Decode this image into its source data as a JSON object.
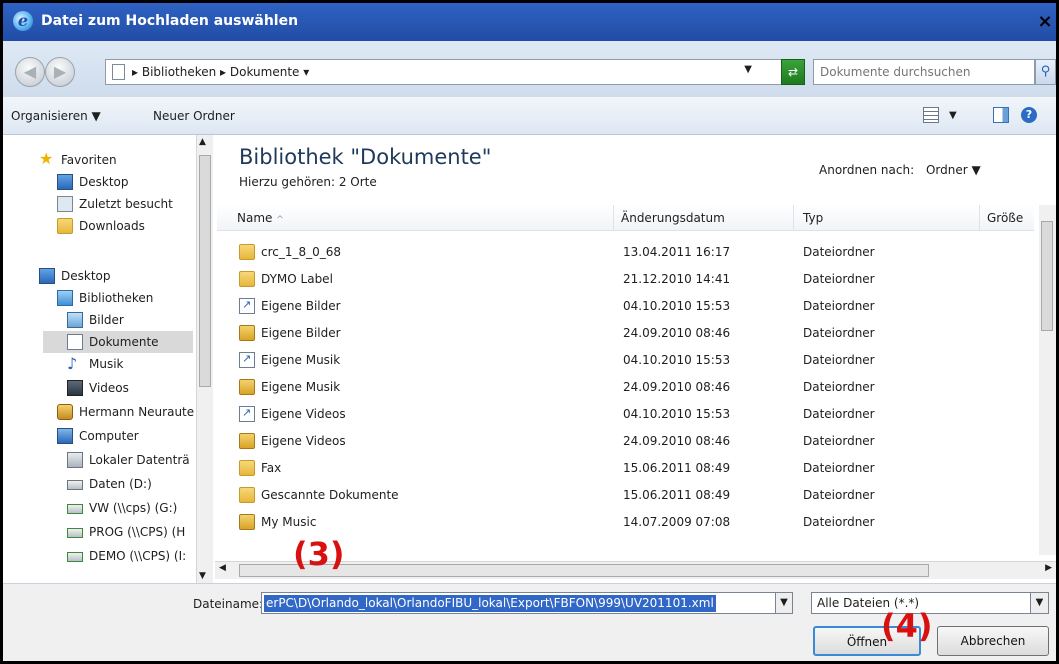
{
  "window": {
    "title": "Datei zum Hochladen auswählen",
    "close": "×"
  },
  "address": {
    "crumbs": "▸ Bibliotheken ▸ Dokumente ▾",
    "search_placeholder": "Dokumente durchsuchen"
  },
  "toolbar": {
    "organize": "Organisieren ▼",
    "new_folder": "Neuer Ordner",
    "help": "?"
  },
  "nav": {
    "items": [
      {
        "label": "Favoriten"
      },
      {
        "label": "Desktop"
      },
      {
        "label": "Zuletzt besucht"
      },
      {
        "label": "Downloads"
      },
      {
        "label": "Desktop"
      },
      {
        "label": "Bibliotheken"
      },
      {
        "label": "Bilder"
      },
      {
        "label": "Dokumente"
      },
      {
        "label": "Musik"
      },
      {
        "label": "Videos"
      },
      {
        "label": "Hermann Neuraute"
      },
      {
        "label": "Computer"
      },
      {
        "label": "Lokaler Datenträ"
      },
      {
        "label": "Daten (D:)"
      },
      {
        "label": "VW (\\\\cps) (G:)"
      },
      {
        "label": "PROG (\\\\CPS) (H"
      },
      {
        "label": "DEMO (\\\\CPS) (I:"
      }
    ]
  },
  "library": {
    "title": "Bibliothek \"Dokumente\"",
    "subtitle": "Hierzu gehören: 2 Orte",
    "arrange_label": "Anordnen nach:",
    "arrange_value": "Ordner ▼"
  },
  "columns": {
    "name": "Name",
    "date": "Änderungsdatum",
    "type": "Typ",
    "size": "Größe"
  },
  "files": [
    {
      "name": "crc_1_8_0_68",
      "date": "13.04.2011 16:17",
      "type": "Dateiordner",
      "icon": "folder"
    },
    {
      "name": "DYMO Label",
      "date": "21.12.2010 14:41",
      "type": "Dateiordner",
      "icon": "folder"
    },
    {
      "name": "Eigene Bilder",
      "date": "04.10.2010 15:53",
      "type": "Dateiordner",
      "icon": "link"
    },
    {
      "name": "Eigene Bilder",
      "date": "24.09.2010 08:46",
      "type": "Dateiordner",
      "icon": "lock"
    },
    {
      "name": "Eigene Musik",
      "date": "04.10.2010 15:53",
      "type": "Dateiordner",
      "icon": "link"
    },
    {
      "name": "Eigene Musik",
      "date": "24.09.2010 08:46",
      "type": "Dateiordner",
      "icon": "lock"
    },
    {
      "name": "Eigene Videos",
      "date": "04.10.2010 15:53",
      "type": "Dateiordner",
      "icon": "link"
    },
    {
      "name": "Eigene Videos",
      "date": "24.09.2010 08:46",
      "type": "Dateiordner",
      "icon": "lock"
    },
    {
      "name": "Fax",
      "date": "15.06.2011 08:49",
      "type": "Dateiordner",
      "icon": "folder"
    },
    {
      "name": "Gescannte Dokumente",
      "date": "15.06.2011 08:49",
      "type": "Dateiordner",
      "icon": "folder"
    },
    {
      "name": "My Music",
      "date": "14.07.2009 07:08",
      "type": "Dateiordner",
      "icon": "lock"
    }
  ],
  "bottom": {
    "filename_label": "Dateiname:",
    "filename_value": "erPC\\D\\Orlando_lokal\\OrlandoFIBU_lokal\\Export\\FBFON\\999\\UV201101.xml",
    "filter_value": "Alle Dateien (*.*)",
    "open_label": "Öffnen",
    "cancel_label": "Abbrechen"
  },
  "annotations": {
    "a3": "(3)",
    "a4": "(4)"
  }
}
